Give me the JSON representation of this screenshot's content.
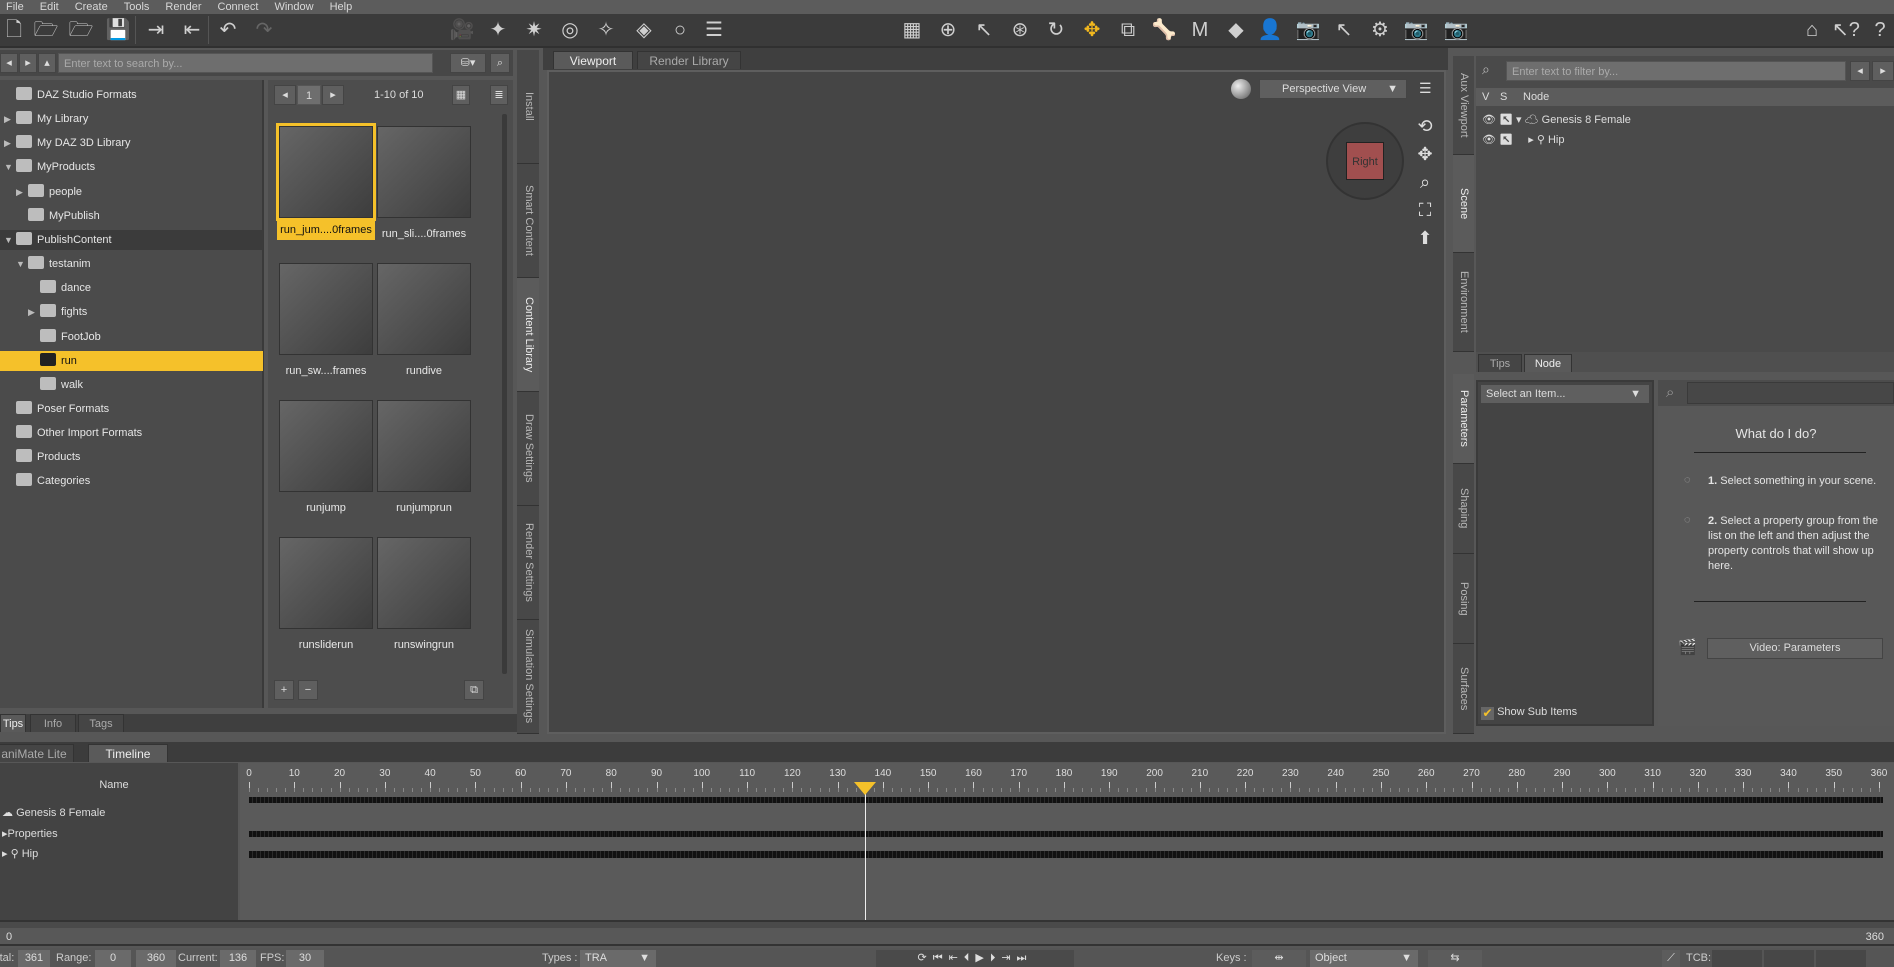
{
  "menu": [
    "File",
    "Edit",
    "Create",
    "Tools",
    "Render",
    "Connect",
    "Window",
    "Help"
  ],
  "content_library": {
    "search_placeholder": "Enter text to search by...",
    "page": "1",
    "count": "1-10 of 10",
    "tree": [
      {
        "label": "DAZ Studio Formats",
        "indent": 0,
        "arrow": ""
      },
      {
        "label": "My Library",
        "indent": 0,
        "arrow": "▶"
      },
      {
        "label": "My DAZ 3D Library",
        "indent": 0,
        "arrow": "▶"
      },
      {
        "label": "MyProducts",
        "indent": 0,
        "arrow": "▼"
      },
      {
        "label": "people",
        "indent": 1,
        "arrow": "▶"
      },
      {
        "label": "MyPublish",
        "indent": 1,
        "arrow": ""
      },
      {
        "label": "PublishContent",
        "indent": 0,
        "arrow": "▼",
        "state": "hl"
      },
      {
        "label": "testanim",
        "indent": 1,
        "arrow": "▼"
      },
      {
        "label": "dance",
        "indent": 2,
        "arrow": ""
      },
      {
        "label": "fights",
        "indent": 2,
        "arrow": "▶"
      },
      {
        "label": "FootJob",
        "indent": 2,
        "arrow": ""
      },
      {
        "label": "run",
        "indent": 2,
        "arrow": "",
        "state": "sel"
      },
      {
        "label": "walk",
        "indent": 2,
        "arrow": ""
      },
      {
        "label": "Poser Formats",
        "indent": 0,
        "arrow": ""
      },
      {
        "label": "Other Import Formats",
        "indent": 0,
        "arrow": ""
      },
      {
        "label": "Products",
        "indent": 0,
        "arrow": ""
      },
      {
        "label": "Categories",
        "indent": 0,
        "arrow": ""
      }
    ],
    "items": [
      {
        "label": "run_jum....0frames",
        "selected": true
      },
      {
        "label": "run_sli....0frames"
      },
      {
        "label": "run_sw....frames"
      },
      {
        "label": "rundive"
      },
      {
        "label": "runjump"
      },
      {
        "label": "runjumprun"
      },
      {
        "label": "runsliderun"
      },
      {
        "label": "runswingrun"
      }
    ],
    "bottom_tabs": [
      "Tips",
      "Info",
      "Tags"
    ]
  },
  "left_vtabs": [
    {
      "label": "Install"
    },
    {
      "label": "Smart Content"
    },
    {
      "label": "Content Library",
      "active": true
    },
    {
      "label": "Draw Settings"
    },
    {
      "label": "Render Settings"
    },
    {
      "label": "Simulation Settings"
    }
  ],
  "viewport": {
    "tabs": [
      "Viewport",
      "Render Library"
    ],
    "view": "Perspective View",
    "cube_label": "Right"
  },
  "right_vtabs_top": [
    {
      "label": "Aux Viewport"
    },
    {
      "label": "Scene",
      "active": true
    },
    {
      "label": "Environment"
    }
  ],
  "right_vtabs_bottom": [
    {
      "label": "Parameters",
      "active": true
    },
    {
      "label": "Shaping"
    },
    {
      "label": "Posing"
    },
    {
      "label": "Surfaces"
    }
  ],
  "scene": {
    "filter_placeholder": "Enter text to filter by...",
    "cols": [
      "V",
      "S",
      "Node"
    ],
    "nodes": [
      "Genesis 8 Female",
      "Hip"
    ]
  },
  "node_tabs": [
    "Tips",
    "Node"
  ],
  "parameters": {
    "select": "Select an Item...",
    "help_title": "What do I do?",
    "step1_num": "1.",
    "step1": "Select something in your scene.",
    "step2_num": "2.",
    "step2": "Select a property group from the list on the left and then adjust the property controls that will show up here.",
    "video_button": "Video: Parameters",
    "show_sub": "Show Sub Items"
  },
  "timeline": {
    "tabs": [
      "aniMate Lite",
      "Timeline"
    ],
    "name_header": "Name",
    "tracks": [
      "Genesis 8 Female",
      "Properties",
      "Hip"
    ],
    "ruler_max": 360,
    "ruler_step": 10,
    "current": 136,
    "scrub_start": "0",
    "scrub_end": "360"
  },
  "status": {
    "total_label": "Total:",
    "total": "361",
    "range_label": "Range:",
    "range_start": "0",
    "range_end": "360",
    "current_label": "Current:",
    "current": "136",
    "fps_label": "FPS:",
    "fps": "30",
    "types_label": "Types :",
    "types": "TRA",
    "keys_label": "Keys :",
    "keys": "Object",
    "tcb_label": "TCB:"
  },
  "colors": {
    "accent": "#f5c12a"
  }
}
